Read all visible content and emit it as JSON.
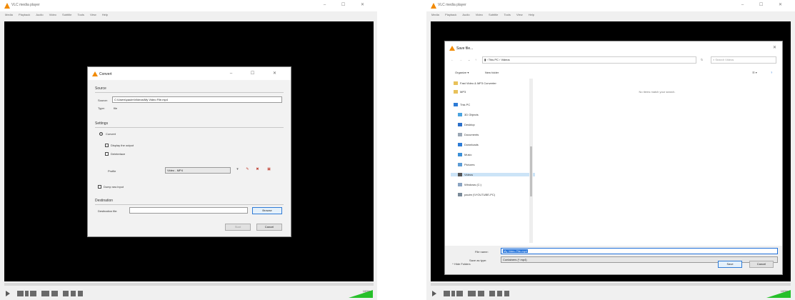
{
  "left_window": {
    "title": "VLC media player",
    "menu": [
      "Media",
      "Playback",
      "Audio",
      "Video",
      "Subtitle",
      "Tools",
      "View",
      "Help"
    ]
  },
  "right_window": {
    "title": "VLC media player",
    "menu": [
      "Media",
      "Playback",
      "Audio",
      "Video",
      "Subtitle",
      "Tools",
      "View",
      "Help"
    ]
  },
  "window_buttons": "–  ☐  ✕",
  "convert_dialog": {
    "title": "Convert",
    "source_section": "Source",
    "source_label": "Source:",
    "source_value": "C:\\Users\\paulm\\Videos\\My Video File.mp4",
    "type_label": "Type:",
    "type_value": "file",
    "settings_section": "Settings",
    "convert_option": "Convert",
    "display_output": "Display the output",
    "deinterlace": "Deinterlace",
    "profile_label": "Profile",
    "profile_value": "Video - MP4",
    "dump_raw": "Dump raw input",
    "destination_section": "Destination",
    "destination_label": "Destination file:",
    "browse": "Browse",
    "start": "Start",
    "cancel": "Cancel"
  },
  "save_dialog": {
    "title": "Save file...",
    "breadcrumb": [
      "This PC",
      "Videos"
    ],
    "search_placeholder": "Search Videos",
    "organize": "Organize ▾",
    "new_folder": "New folder",
    "empty_message": "No items match your search.",
    "tree": [
      "Fast Video & MP3 Converter",
      "MP3",
      "This PC",
      "3D Objects",
      "Desktop",
      "Documents",
      "Downloads",
      "Music",
      "Pictures",
      "Videos",
      "Windows (C:)",
      "paulm (\\\\YOUTUBE-PC)"
    ],
    "selected_tree_item": "Videos",
    "file_name_label": "File name:",
    "file_name_value": "My Video File.mp4",
    "save_type_label": "Save as type:",
    "save_type_value": "Containers (*.mp4)",
    "hide_folders": "Hide Folders",
    "save_button": "Save",
    "cancel_button": "Cancel"
  },
  "volume": "100%",
  "colors": {
    "video": "#000000",
    "volume_green": "#26c02a",
    "vlc_orange": "#f28a00",
    "selection_blue": "#1e6fd9"
  }
}
